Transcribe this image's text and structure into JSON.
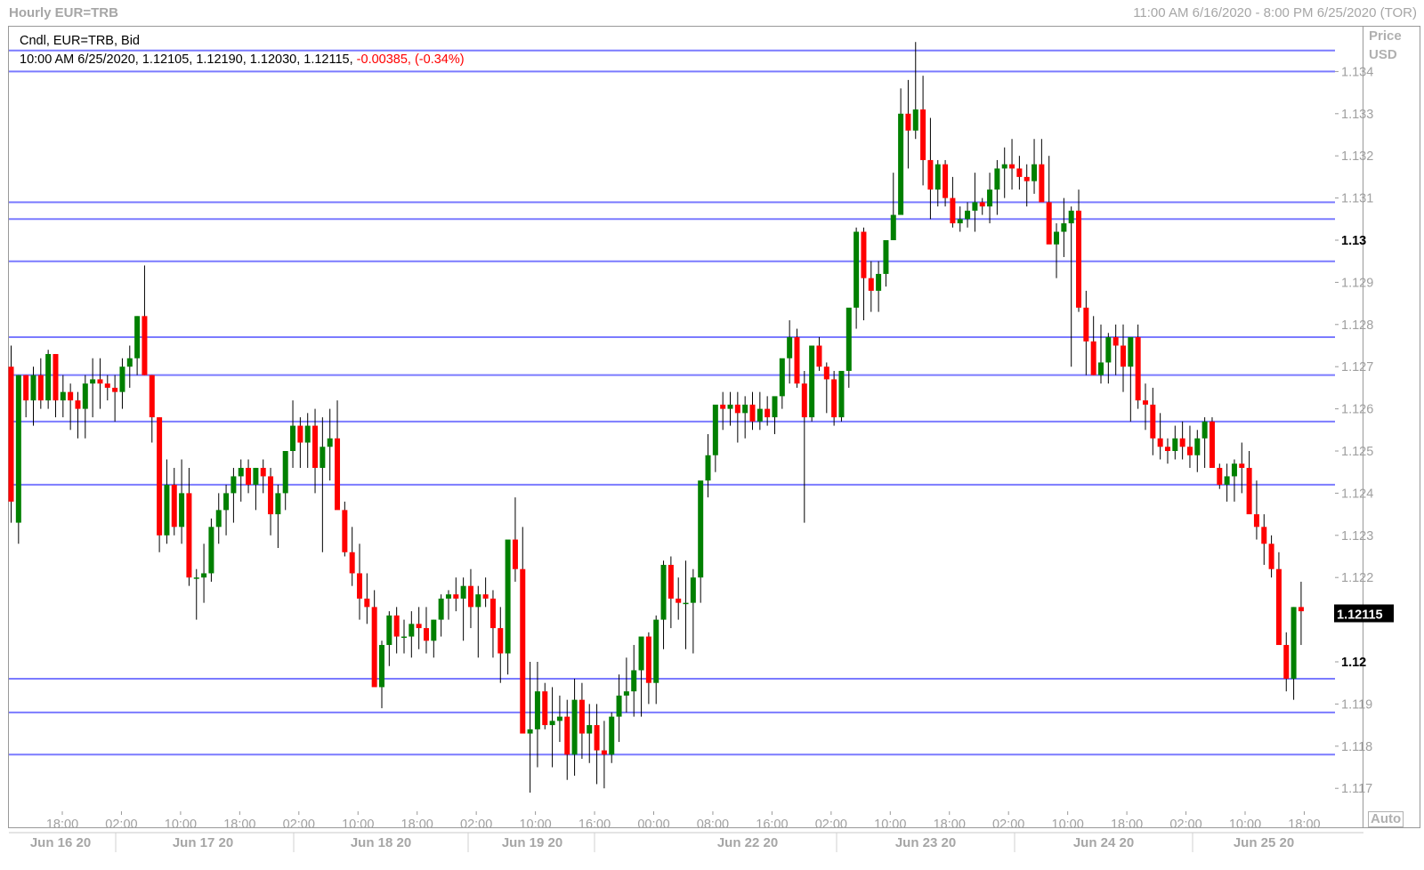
{
  "window": {
    "title": "Hourly EUR=TRB",
    "range": "11:00 AM 6/16/2020 - 8:00 PM 6/25/2020 (TOR)"
  },
  "legend": {
    "series": "Cndl, EUR=TRB, Bid",
    "ohlc": "10:00 AM 6/25/2020, 1.12105, 1.12190, 1.12030, 1.12115,",
    "change": "-0.00385, (-0.34%)"
  },
  "price_axis": {
    "title_line1": "Price",
    "title_line2": "USD",
    "auto_label": "Auto",
    "last_price": "1.12115"
  },
  "colors": {
    "up": "#008000",
    "down": "#ff0000",
    "hline": "#7b7bff",
    "last_price_bg": "#000000"
  },
  "chart_data": {
    "type": "candlestick",
    "ylim": [
      1.1165,
      1.135
    ],
    "yticks": [
      {
        "v": 1.134,
        "label": "1.134",
        "bold": false
      },
      {
        "v": 1.133,
        "label": "1.133",
        "bold": false
      },
      {
        "v": 1.132,
        "label": "1.132",
        "bold": false
      },
      {
        "v": 1.131,
        "label": "1.131",
        "bold": false
      },
      {
        "v": 1.13,
        "label": "1.13",
        "bold": true
      },
      {
        "v": 1.129,
        "label": "1.129",
        "bold": false
      },
      {
        "v": 1.128,
        "label": "1.128",
        "bold": false
      },
      {
        "v": 1.127,
        "label": "1.127",
        "bold": false
      },
      {
        "v": 1.126,
        "label": "1.126",
        "bold": false
      },
      {
        "v": 1.125,
        "label": "1.125",
        "bold": false
      },
      {
        "v": 1.124,
        "label": "1.124",
        "bold": false
      },
      {
        "v": 1.123,
        "label": "1.123",
        "bold": false
      },
      {
        "v": 1.122,
        "label": "1.122",
        "bold": false
      },
      {
        "v": 1.12,
        "label": "1.12",
        "bold": true
      },
      {
        "v": 1.119,
        "label": "1.119",
        "bold": false
      },
      {
        "v": 1.118,
        "label": "1.118",
        "bold": false
      },
      {
        "v": 1.117,
        "label": "1.117",
        "bold": false
      }
    ],
    "time_labels": [
      "18:00",
      "02:00",
      "10:00",
      "18:00",
      "02:00",
      "10:00",
      "18:00",
      "02:00",
      "10:00",
      "16:00",
      "00:00",
      "08:00",
      "16:00",
      "02:00",
      "10:00",
      "18:00",
      "02:00",
      "10:00",
      "18:00",
      "02:00",
      "10:00",
      "18:00"
    ],
    "date_labels": [
      "Jun 16 20",
      "Jun 17 20",
      "Jun 18 20",
      "Jun 19 20",
      "Jun 22 20",
      "Jun 23 20",
      "Jun 24 20",
      "Jun 25 20"
    ],
    "hlines": [
      1.1345,
      1.134,
      1.1309,
      1.1305,
      1.1295,
      1.1277,
      1.1268,
      1.1257,
      1.1242,
      1.1196,
      1.1188,
      1.1178
    ],
    "candles": [
      [
        1.127,
        1.1275,
        1.1233,
        1.1238
      ],
      [
        1.1233,
        1.1268,
        1.1228,
        1.1268
      ],
      [
        1.1268,
        1.1268,
        1.1258,
        1.1262
      ],
      [
        1.1262,
        1.127,
        1.1256,
        1.1268
      ],
      [
        1.1268,
        1.1272,
        1.126,
        1.1262
      ],
      [
        1.1262,
        1.1274,
        1.126,
        1.1273
      ],
      [
        1.1273,
        1.1273,
        1.1258,
        1.1262
      ],
      [
        1.1262,
        1.1268,
        1.1258,
        1.1264
      ],
      [
        1.1264,
        1.1266,
        1.1255,
        1.1262
      ],
      [
        1.1262,
        1.1264,
        1.1253,
        1.126
      ],
      [
        1.126,
        1.1268,
        1.1253,
        1.1266
      ],
      [
        1.1266,
        1.1272,
        1.1258,
        1.1267
      ],
      [
        1.1267,
        1.1272,
        1.126,
        1.1266
      ],
      [
        1.1266,
        1.1268,
        1.1262,
        1.1265
      ],
      [
        1.1265,
        1.1268,
        1.1257,
        1.1264
      ],
      [
        1.1264,
        1.1272,
        1.126,
        1.127
      ],
      [
        1.127,
        1.1275,
        1.1265,
        1.1272
      ],
      [
        1.1272,
        1.1282,
        1.1268,
        1.1282
      ],
      [
        1.1282,
        1.1294,
        1.1268,
        1.1268
      ],
      [
        1.1268,
        1.1268,
        1.1252,
        1.1258
      ],
      [
        1.1258,
        1.1258,
        1.1226,
        1.123
      ],
      [
        1.123,
        1.1248,
        1.1228,
        1.1242
      ],
      [
        1.1242,
        1.1246,
        1.123,
        1.1232
      ],
      [
        1.1232,
        1.1248,
        1.1228,
        1.124
      ],
      [
        1.124,
        1.1246,
        1.1218,
        1.122
      ],
      [
        1.122,
        1.1222,
        1.121,
        1.122
      ],
      [
        1.122,
        1.1228,
        1.1214,
        1.1221
      ],
      [
        1.1221,
        1.1234,
        1.1219,
        1.1232
      ],
      [
        1.1232,
        1.124,
        1.1228,
        1.1236
      ],
      [
        1.1236,
        1.1242,
        1.123,
        1.124
      ],
      [
        1.124,
        1.1246,
        1.1233,
        1.1244
      ],
      [
        1.1244,
        1.1248,
        1.1238,
        1.1246
      ],
      [
        1.1246,
        1.1248,
        1.124,
        1.1242
      ],
      [
        1.1242,
        1.1246,
        1.1236,
        1.1246
      ],
      [
        1.1246,
        1.1248,
        1.124,
        1.1244
      ],
      [
        1.1244,
        1.1246,
        1.123,
        1.1235
      ],
      [
        1.1235,
        1.1242,
        1.1227,
        1.124
      ],
      [
        1.124,
        1.1248,
        1.1236,
        1.125
      ],
      [
        1.125,
        1.1262,
        1.1246,
        1.1256
      ],
      [
        1.1256,
        1.1258,
        1.1246,
        1.1252
      ],
      [
        1.1252,
        1.1259,
        1.1246,
        1.1256
      ],
      [
        1.1256,
        1.126,
        1.124,
        1.1246
      ],
      [
        1.1246,
        1.1258,
        1.1226,
        1.1251
      ],
      [
        1.1251,
        1.126,
        1.1243,
        1.1253
      ],
      [
        1.1253,
        1.1262,
        1.124,
        1.1236
      ],
      [
        1.1236,
        1.1238,
        1.1225,
        1.1226
      ],
      [
        1.1226,
        1.1232,
        1.1218,
        1.1221
      ],
      [
        1.1221,
        1.1228,
        1.121,
        1.1215
      ],
      [
        1.1215,
        1.1221,
        1.1209,
        1.1213
      ],
      [
        1.1213,
        1.1217,
        1.1197,
        1.1194
      ],
      [
        1.1194,
        1.1205,
        1.1189,
        1.1204
      ],
      [
        1.1204,
        1.1212,
        1.1199,
        1.1211
      ],
      [
        1.1211,
        1.1213,
        1.1202,
        1.1206
      ],
      [
        1.1206,
        1.121,
        1.1202,
        1.1206
      ],
      [
        1.1206,
        1.1212,
        1.1201,
        1.1209
      ],
      [
        1.1209,
        1.1213,
        1.1203,
        1.1208
      ],
      [
        1.1208,
        1.1213,
        1.1202,
        1.1205
      ],
      [
        1.1205,
        1.121,
        1.1201,
        1.121
      ],
      [
        1.121,
        1.1216,
        1.1206,
        1.1215
      ],
      [
        1.1215,
        1.1217,
        1.121,
        1.1216
      ],
      [
        1.1216,
        1.122,
        1.1212,
        1.1215
      ],
      [
        1.1215,
        1.122,
        1.1205,
        1.1218
      ],
      [
        1.1218,
        1.1222,
        1.1208,
        1.1213
      ],
      [
        1.1213,
        1.1218,
        1.1201,
        1.1216
      ],
      [
        1.1216,
        1.122,
        1.1213,
        1.1215
      ],
      [
        1.1215,
        1.1217,
        1.1201,
        1.1208
      ],
      [
        1.1208,
        1.1213,
        1.1195,
        1.1202
      ],
      [
        1.1202,
        1.1227,
        1.1197,
        1.1229
      ],
      [
        1.1229,
        1.1239,
        1.1219,
        1.1222
      ],
      [
        1.1222,
        1.1232,
        1.1193,
        1.1183
      ],
      [
        1.1183,
        1.12,
        1.1169,
        1.1184
      ],
      [
        1.1184,
        1.12,
        1.1175,
        1.1193
      ],
      [
        1.1193,
        1.1195,
        1.1184,
        1.1185
      ],
      [
        1.1185,
        1.1194,
        1.1175,
        1.1186
      ],
      [
        1.1186,
        1.1192,
        1.1181,
        1.1187
      ],
      [
        1.1187,
        1.1191,
        1.1172,
        1.1178
      ],
      [
        1.1178,
        1.1196,
        1.1173,
        1.1191
      ],
      [
        1.1191,
        1.1195,
        1.1177,
        1.1183
      ],
      [
        1.1183,
        1.119,
        1.1176,
        1.1185
      ],
      [
        1.1185,
        1.119,
        1.1171,
        1.1179
      ],
      [
        1.1179,
        1.1186,
        1.117,
        1.1178
      ],
      [
        1.1178,
        1.1188,
        1.1176,
        1.1187
      ],
      [
        1.1187,
        1.1197,
        1.1181,
        1.1192
      ],
      [
        1.1192,
        1.1201,
        1.1188,
        1.1193
      ],
      [
        1.1193,
        1.1204,
        1.1187,
        1.1198
      ],
      [
        1.1198,
        1.1205,
        1.1187,
        1.1206
      ],
      [
        1.1206,
        1.1207,
        1.119,
        1.1195
      ],
      [
        1.1195,
        1.1211,
        1.119,
        1.121
      ],
      [
        1.121,
        1.1224,
        1.1203,
        1.1223
      ],
      [
        1.1223,
        1.1225,
        1.1208,
        1.1215
      ],
      [
        1.1215,
        1.122,
        1.121,
        1.1214
      ],
      [
        1.1214,
        1.1224,
        1.1203,
        1.1214
      ],
      [
        1.1214,
        1.1222,
        1.1202,
        1.122
      ],
      [
        1.122,
        1.1241,
        1.1214,
        1.1243
      ],
      [
        1.1243,
        1.1254,
        1.1239,
        1.1249
      ],
      [
        1.1249,
        1.126,
        1.1245,
        1.1261
      ],
      [
        1.1261,
        1.1264,
        1.1255,
        1.126
      ],
      [
        1.126,
        1.1264,
        1.1256,
        1.1261
      ],
      [
        1.1261,
        1.1264,
        1.1252,
        1.1259
      ],
      [
        1.1259,
        1.1263,
        1.1253,
        1.1261
      ],
      [
        1.1261,
        1.1264,
        1.1255,
        1.1257
      ],
      [
        1.1257,
        1.1264,
        1.1255,
        1.126
      ],
      [
        1.126,
        1.1263,
        1.1256,
        1.1258
      ],
      [
        1.1258,
        1.1261,
        1.1254,
        1.1263
      ],
      [
        1.1263,
        1.1268,
        1.126,
        1.1272
      ],
      [
        1.1272,
        1.1281,
        1.1266,
        1.1277
      ],
      [
        1.1277,
        1.1279,
        1.1265,
        1.1266
      ],
      [
        1.1266,
        1.1269,
        1.1233,
        1.1258
      ],
      [
        1.1258,
        1.1275,
        1.1257,
        1.1275
      ],
      [
        1.1275,
        1.1277,
        1.1269,
        1.127
      ],
      [
        1.127,
        1.1271,
        1.1259,
        1.1267
      ],
      [
        1.1267,
        1.1269,
        1.1256,
        1.1258
      ],
      [
        1.1258,
        1.1268,
        1.1257,
        1.1269
      ],
      [
        1.1269,
        1.128,
        1.1265,
        1.1284
      ],
      [
        1.1284,
        1.1303,
        1.1279,
        1.1302
      ],
      [
        1.1302,
        1.1303,
        1.1281,
        1.1291
      ],
      [
        1.1291,
        1.1295,
        1.1283,
        1.1288
      ],
      [
        1.1288,
        1.1295,
        1.1283,
        1.1292
      ],
      [
        1.1292,
        1.13,
        1.1289,
        1.13
      ],
      [
        1.13,
        1.1316,
        1.1304,
        1.1306
      ],
      [
        1.1306,
        1.1336,
        1.1318,
        1.133
      ],
      [
        1.133,
        1.1338,
        1.1317,
        1.1326
      ],
      [
        1.1326,
        1.1347,
        1.1324,
        1.1331
      ],
      [
        1.1331,
        1.1339,
        1.1313,
        1.1319
      ],
      [
        1.1319,
        1.1329,
        1.1305,
        1.1312
      ],
      [
        1.1312,
        1.1319,
        1.1308,
        1.1318
      ],
      [
        1.1318,
        1.1319,
        1.1308,
        1.131
      ],
      [
        1.131,
        1.1315,
        1.1303,
        1.1304
      ],
      [
        1.1304,
        1.1308,
        1.1302,
        1.1305
      ],
      [
        1.1305,
        1.1309,
        1.1303,
        1.1307
      ],
      [
        1.1307,
        1.1316,
        1.1302,
        1.1309
      ],
      [
        1.1309,
        1.131,
        1.1306,
        1.1308
      ],
      [
        1.1308,
        1.1316,
        1.1304,
        1.1312
      ],
      [
        1.1312,
        1.1319,
        1.1306,
        1.1317
      ],
      [
        1.1317,
        1.1322,
        1.131,
        1.1318
      ],
      [
        1.1318,
        1.1324,
        1.1312,
        1.1317
      ],
      [
        1.1317,
        1.132,
        1.1312,
        1.1315
      ],
      [
        1.1315,
        1.1318,
        1.1308,
        1.1314
      ],
      [
        1.1314,
        1.1324,
        1.1311,
        1.1318
      ],
      [
        1.1318,
        1.1324,
        1.131,
        1.1309
      ],
      [
        1.1309,
        1.132,
        1.13,
        1.1299
      ],
      [
        1.1299,
        1.1304,
        1.1291,
        1.1302
      ],
      [
        1.1302,
        1.131,
        1.1296,
        1.1304
      ],
      [
        1.1304,
        1.1308,
        1.127,
        1.1307
      ],
      [
        1.1307,
        1.1312,
        1.1283,
        1.1284
      ],
      [
        1.1284,
        1.1288,
        1.1268,
        1.1276
      ],
      [
        1.1276,
        1.1282,
        1.1268,
        1.1268
      ],
      [
        1.1268,
        1.128,
        1.1266,
        1.1271
      ],
      [
        1.1271,
        1.1278,
        1.1266,
        1.1277
      ],
      [
        1.1277,
        1.128,
        1.1268,
        1.1275
      ],
      [
        1.1275,
        1.128,
        1.1264,
        1.127
      ],
      [
        1.127,
        1.1276,
        1.1257,
        1.1277
      ],
      [
        1.1277,
        1.128,
        1.126,
        1.1262
      ],
      [
        1.1262,
        1.1266,
        1.1255,
        1.1261
      ],
      [
        1.1261,
        1.1265,
        1.1249,
        1.1253
      ],
      [
        1.1253,
        1.1259,
        1.1248,
        1.1251
      ],
      [
        1.1251,
        1.1253,
        1.1247,
        1.125
      ],
      [
        1.125,
        1.1256,
        1.1248,
        1.1253
      ],
      [
        1.1253,
        1.1257,
        1.1248,
        1.1251
      ],
      [
        1.1251,
        1.1256,
        1.1246,
        1.1249
      ],
      [
        1.1249,
        1.1255,
        1.1245,
        1.1253
      ],
      [
        1.1253,
        1.1258,
        1.1246,
        1.1257
      ],
      [
        1.1257,
        1.1258,
        1.1246,
        1.1246
      ],
      [
        1.1246,
        1.1247,
        1.1241,
        1.1242
      ],
      [
        1.1242,
        1.1247,
        1.1238,
        1.1244
      ],
      [
        1.1244,
        1.1248,
        1.1238,
        1.1247
      ],
      [
        1.1247,
        1.1252,
        1.124,
        1.1246
      ],
      [
        1.1246,
        1.125,
        1.1238,
        1.1235
      ],
      [
        1.1235,
        1.1243,
        1.1229,
        1.1232
      ],
      [
        1.1232,
        1.1235,
        1.1223,
        1.1228
      ],
      [
        1.1228,
        1.123,
        1.122,
        1.1222
      ],
      [
        1.1222,
        1.1226,
        1.1213,
        1.1204
      ],
      [
        1.1204,
        1.1207,
        1.1193,
        1.1196
      ],
      [
        1.1196,
        1.1213,
        1.1191,
        1.1213
      ],
      [
        1.1213,
        1.1219,
        1.1204,
        1.1212
      ]
    ]
  }
}
